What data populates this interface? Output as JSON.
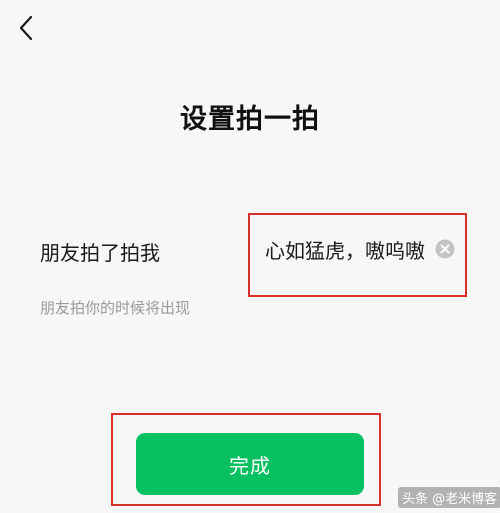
{
  "header": {
    "back_icon": "chevron-left-icon",
    "title": "设置拍一拍"
  },
  "pat_row": {
    "label": "朋友拍了拍我",
    "suffix_value": "心如猛虎，嗷呜嗷",
    "clear_icon": "clear-circle-icon"
  },
  "hint": {
    "text": "朋友拍你的时候将出现"
  },
  "footer": {
    "done_label": "完成"
  },
  "watermark": {
    "text": "头条 @老米博客"
  },
  "colors": {
    "accent_green": "#07c160",
    "highlight_red": "#d9302c",
    "background": "#f7f7f7"
  }
}
